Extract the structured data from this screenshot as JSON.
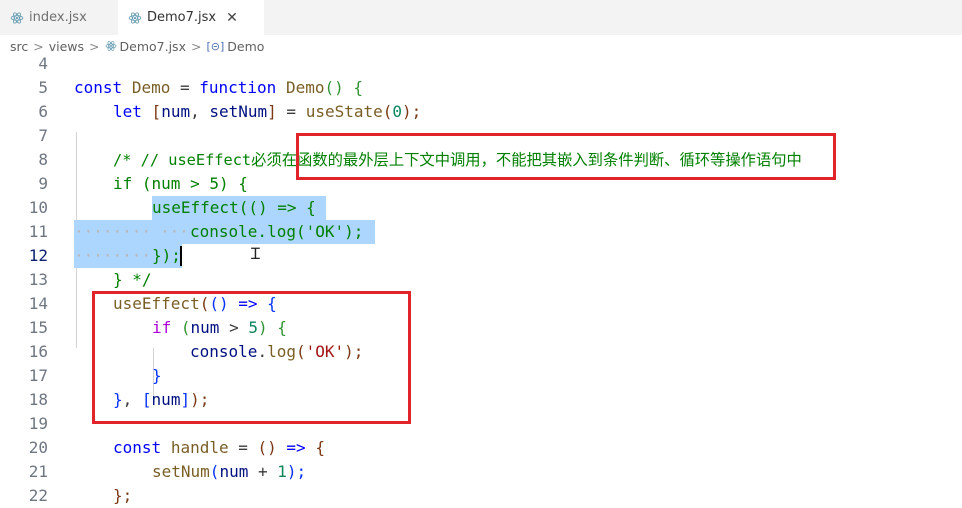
{
  "tabs": [
    {
      "label": "index.jsx",
      "icon": "react-icon",
      "active": false
    },
    {
      "label": "Demo7.jsx",
      "icon": "react-icon",
      "active": true,
      "close": "✕"
    }
  ],
  "breadcrumb": {
    "items": [
      "src",
      "views",
      "Demo7.jsx",
      "Demo"
    ],
    "separator": ">"
  },
  "editor": {
    "lines": [
      {
        "n": "4"
      },
      {
        "n": "5"
      },
      {
        "n": "6"
      },
      {
        "n": "7"
      },
      {
        "n": "8"
      },
      {
        "n": "9"
      },
      {
        "n": "10"
      },
      {
        "n": "11"
      },
      {
        "n": "12"
      },
      {
        "n": "13"
      },
      {
        "n": "14"
      },
      {
        "n": "15"
      },
      {
        "n": "16"
      },
      {
        "n": "17"
      },
      {
        "n": "18"
      },
      {
        "n": "19"
      },
      {
        "n": "20"
      },
      {
        "n": "21"
      },
      {
        "n": "22"
      }
    ],
    "text": {
      "l5_const": "const",
      "l5_demo": "Demo",
      "l5_eq": " = ",
      "l5_function": "function",
      "l5_demo2": "Demo",
      "l5_paren": "()",
      "l5_brace": "{",
      "l6_let": "let",
      "l6_open": "[",
      "l6_num": "num",
      "l6_comma": ", ",
      "l6_setnum": "setNum",
      "l6_close": "]",
      "l6_eq": " = ",
      "l6_usestate": "useState",
      "l6_p1": "(",
      "l6_zero": "0",
      "l6_p2": ");",
      "l8_comment": "/* // useEffect必须在函数的最外层上下文中调用，不能把其嵌入到条件判断、循环等操作语句中",
      "l9": "if (num > 5) {",
      "l10_sel": "useEffect(() => {",
      "l11_sel": "console.log('OK');",
      "l12_sel": "});",
      "l13": "} */",
      "l14_fn": "useEffect",
      "l14_p": "(",
      "l14_pp": "()",
      "l14_arrow": " => ",
      "l14_brace": "{",
      "l15_if": "if",
      "l15_p1": " (",
      "l15_num": "num",
      "l15_gt": " > ",
      "l15_five": "5",
      "l15_p2": ")",
      "l15_brace": " {",
      "l16_console": "console",
      "l16_dot": ".",
      "l16_log": "log",
      "l16_p1": "(",
      "l16_str": "'OK'",
      "l16_p2": ");",
      "l17_brace": "}",
      "l18_close": "}",
      "l18_comma": ", ",
      "l18_open": "[",
      "l18_num": "num",
      "l18_close2": "]",
      "l18_end": ");",
      "l20_const": "const",
      "l20_handle": "handle",
      "l20_eq": " = ",
      "l20_pp": "()",
      "l20_arrow": " => ",
      "l20_brace": "{",
      "l21_setnum": "setNum",
      "l21_p1": "(",
      "l21_num": "num",
      "l21_plus": " + ",
      "l21_one": "1",
      "l21_p2": ");",
      "l22": "};"
    }
  },
  "colors": {
    "annotation": "#e0242a",
    "selection": "#add6ff",
    "keyword": "#0000ff",
    "control_keyword": "#af00db",
    "comment": "#008000",
    "string": "#a31515",
    "number": "#098658",
    "function": "#795e26",
    "variable": "#001080"
  }
}
